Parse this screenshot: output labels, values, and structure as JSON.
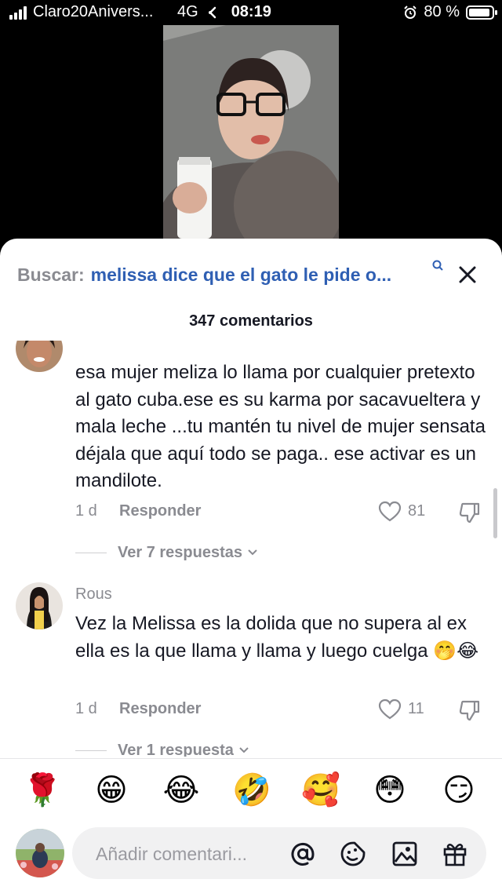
{
  "status_bar": {
    "carrier": "Claro20Anivers...",
    "network": "4G",
    "time": "08:19",
    "battery": "80 %",
    "battery_level": 0.8
  },
  "comments_sheet": {
    "search_prefix": "Buscar:",
    "search_query": "melissa dice que el gato le pide o...",
    "count_label": "347 comentarios",
    "comments": [
      {
        "username": "",
        "text": "esa mujer meliza lo llama por cualquier pretexto al gato cuba.ese es su karma por sacavueltera y mala leche ...tu mantén tu nivel de mujer sensata déjala que aquí todo se paga.. ese activar es un mandilote.",
        "time": "1 d",
        "reply_label": "Responder",
        "likes": "81",
        "view_replies": "Ver 7 respuestas"
      },
      {
        "username": "Rous",
        "text": "Vez la Melissa es la dolida que no supera al ex ella es la que llama y llama y luego cuelga 🤭😂",
        "time": "1 d",
        "reply_label": "Responder",
        "likes": "11",
        "view_replies": "Ver 1 respuesta"
      }
    ]
  },
  "emoji_bar": [
    "🌹",
    "😁",
    "😂",
    "🤣",
    "🥰",
    "😳",
    "😏"
  ],
  "comment_input": {
    "placeholder": "Añadir comentari..."
  },
  "colors": {
    "accent_link": "#2f5fb3",
    "muted_text": "#8a8b91",
    "primary_text": "#161823"
  }
}
